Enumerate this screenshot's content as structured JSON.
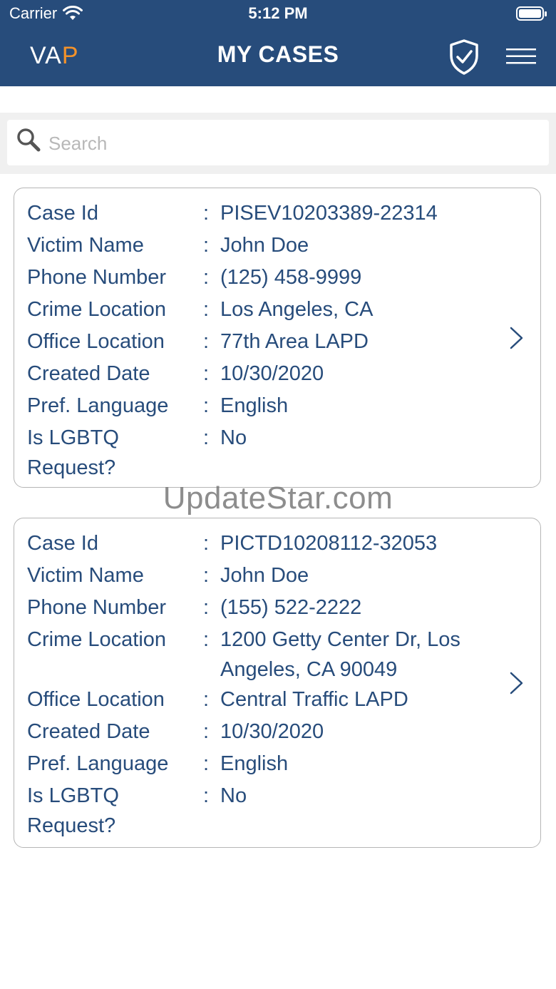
{
  "status_bar": {
    "carrier": "Carrier",
    "time": "5:12 PM"
  },
  "header": {
    "brand_prefix": "VA",
    "brand_accent": "P",
    "title": "MY CASES",
    "icons": [
      "shield-check-icon",
      "hamburger-menu-icon"
    ],
    "background_color": "#274c7b",
    "accent_color": "#f3922a"
  },
  "search": {
    "placeholder": "Search",
    "value": ""
  },
  "cases": [
    {
      "case_id_label": "Case Id",
      "case_id": "PISEV10203389-22314",
      "victim_name_label": "Victim Name",
      "victim_name": "John Doe",
      "phone_label": "Phone Number",
      "phone": "(125) 458-9999",
      "crime_location_label": "Crime Location",
      "crime_location": "Los Angeles, CA",
      "office_location_label": "Office Location",
      "office_location": "77th Area LAPD",
      "created_date_label": "Created Date",
      "created_date": "10/30/2020",
      "pref_language_label": "Pref. Language",
      "pref_language": "English",
      "lgbtq_label": "Is LGBTQ Request?",
      "lgbtq": "No"
    },
    {
      "case_id_label": "Case Id",
      "case_id": "PICTD10208112-32053",
      "victim_name_label": "Victim Name",
      "victim_name": "John Doe",
      "phone_label": "Phone Number",
      "phone": "(155) 522-2222",
      "crime_location_label": "Crime Location",
      "crime_location": "1200 Getty Center Dr, Los Angeles, CA 90049",
      "office_location_label": "Office Location",
      "office_location": "Central Traffic LAPD",
      "created_date_label": "Created Date",
      "created_date": "10/30/2020",
      "pref_language_label": "Pref. Language",
      "pref_language": "English",
      "lgbtq_label": "Is LGBTQ Request?",
      "lgbtq": "No"
    }
  ],
  "watermark": "UpdateStar.com"
}
